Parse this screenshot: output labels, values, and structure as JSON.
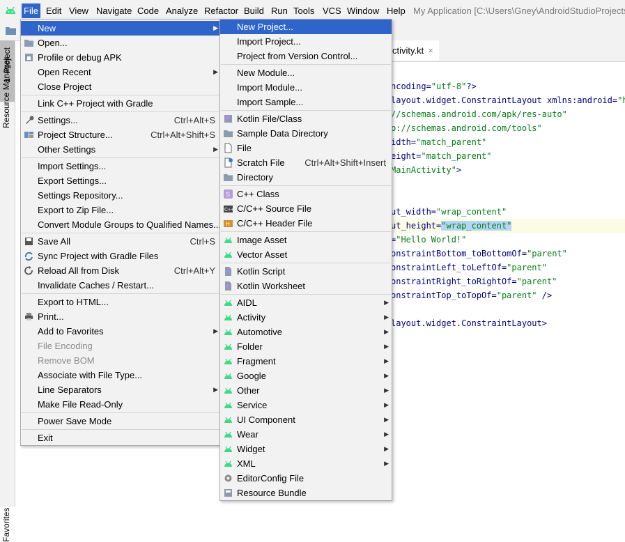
{
  "menubar": {
    "items": [
      "File",
      "Edit",
      "View",
      "Navigate",
      "Code",
      "Analyze",
      "Refactor",
      "Build",
      "Run",
      "Tools",
      "VCS",
      "Window",
      "Help"
    ],
    "window_title": "My Application [C:\\Users\\Gney\\AndroidStudioProjects\\"
  },
  "tool_windows": {
    "resource_manager": "Resource Manager",
    "project": "1: Project",
    "favorites": "Favorites"
  },
  "editor": {
    "tab_label": "ctivity.kt",
    "tab_close": "×",
    "lines": [
      {
        "pre": "ncoding=",
        "str": "\"utf-8\"",
        "post": "?>"
      },
      {
        "pre": "layout.widget.ConstraintLayout xmlns:android=",
        "str": "\"htt",
        "post": ""
      },
      {
        "pre": "",
        "str": "//schemas.android.com/apk/res-auto\"",
        "post": ""
      },
      {
        "pre": "",
        "str": "p://schemas.android.com/tools\"",
        "post": ""
      },
      {
        "pre": "idth=",
        "str": "\"match_parent\"",
        "post": ""
      },
      {
        "pre": "eight=",
        "str": "\"match_parent\"",
        "post": ""
      },
      {
        "pre": "",
        "str": "MainActivity\"",
        "post": ">"
      },
      {
        "pre": "",
        "str": "",
        "post": ""
      },
      {
        "pre": "",
        "str": "",
        "post": ""
      },
      {
        "pre": "ut_width=",
        "str": "\"wrap_content\"",
        "post": ""
      },
      {
        "pre": "ut_height=",
        "str": "\"wrap_content\"",
        "post": ""
      },
      {
        "pre": "=",
        "str": "\"Hello World!\"",
        "post": ""
      },
      {
        "pre": "onstraintBottom_toBottomOf=",
        "str": "\"parent\"",
        "post": ""
      },
      {
        "pre": "onstraintLeft_toLeftOf=",
        "str": "\"parent\"",
        "post": ""
      },
      {
        "pre": "onstraintRight_toRightOf=",
        "str": "\"parent\"",
        "post": ""
      },
      {
        "pre": "onstraintTop_toTopOf=",
        "str": "\"parent\"",
        "post": " />"
      },
      {
        "pre": "",
        "str": "",
        "post": ""
      },
      {
        "pre": "layout.widget.ConstraintLayout>",
        "str": "",
        "post": ""
      }
    ]
  },
  "file_menu": {
    "items": [
      {
        "label": "New",
        "submenu": true,
        "selected": true
      },
      {
        "label": "Open...",
        "icon": "folder-icon"
      },
      {
        "label": "Profile or debug APK",
        "icon": "apk-icon"
      },
      {
        "label": "Open Recent",
        "submenu": true
      },
      {
        "label": "Close Project"
      },
      {
        "sep": true
      },
      {
        "label": "Link C++ Project with Gradle"
      },
      {
        "sep": true
      },
      {
        "label": "Settings...",
        "shortcut": "Ctrl+Alt+S",
        "icon": "wrench-icon"
      },
      {
        "label": "Project Structure...",
        "shortcut": "Ctrl+Alt+Shift+S",
        "icon": "project-structure-icon"
      },
      {
        "label": "Other Settings",
        "submenu": true
      },
      {
        "sep": true
      },
      {
        "label": "Import Settings..."
      },
      {
        "label": "Export Settings..."
      },
      {
        "label": "Settings Repository..."
      },
      {
        "label": "Export to Zip File..."
      },
      {
        "label": "Convert Module Groups to Qualified Names..."
      },
      {
        "sep": true
      },
      {
        "label": "Save All",
        "shortcut": "Ctrl+S",
        "icon": "save-icon"
      },
      {
        "label": "Sync Project with Gradle Files",
        "icon": "gradle-sync-icon"
      },
      {
        "label": "Reload All from Disk",
        "shortcut": "Ctrl+Alt+Y",
        "icon": "reload-icon"
      },
      {
        "label": "Invalidate Caches / Restart..."
      },
      {
        "sep": true
      },
      {
        "label": "Export to HTML..."
      },
      {
        "label": "Print...",
        "icon": "print-icon"
      },
      {
        "label": "Add to Favorites",
        "submenu": true
      },
      {
        "label": "File Encoding",
        "disabled": true
      },
      {
        "label": "Remove BOM",
        "disabled": true
      },
      {
        "label": "Associate with File Type..."
      },
      {
        "label": "Line Separators",
        "submenu": true
      },
      {
        "label": "Make File Read-Only"
      },
      {
        "sep": true
      },
      {
        "label": "Power Save Mode"
      },
      {
        "sep": true
      },
      {
        "label": "Exit"
      }
    ]
  },
  "new_menu": {
    "items": [
      {
        "label": "New Project...",
        "selected": true
      },
      {
        "label": "Import Project..."
      },
      {
        "label": "Project from Version Control..."
      },
      {
        "sep": true
      },
      {
        "label": "New Module..."
      },
      {
        "label": "Import Module..."
      },
      {
        "label": "Import Sample..."
      },
      {
        "sep": true
      },
      {
        "label": "Kotlin File/Class",
        "icon": "kotlin-icon"
      },
      {
        "label": "Sample Data Directory",
        "icon": "folder-icon"
      },
      {
        "label": "File",
        "icon": "file-icon"
      },
      {
        "label": "Scratch File",
        "shortcut": "Ctrl+Alt+Shift+Insert",
        "icon": "scratch-file-icon"
      },
      {
        "label": "Directory",
        "icon": "folder-icon"
      },
      {
        "sep": true
      },
      {
        "label": "C++ Class",
        "icon": "cpp-class-icon"
      },
      {
        "label": "C/C++ Source File",
        "icon": "cpp-source-icon"
      },
      {
        "label": "C/C++ Header File",
        "icon": "cpp-header-icon"
      },
      {
        "sep": true
      },
      {
        "label": "Image Asset",
        "icon": "android-icon"
      },
      {
        "label": "Vector Asset",
        "icon": "android-icon"
      },
      {
        "sep": true
      },
      {
        "label": "Kotlin Script",
        "icon": "kotlin-script-icon"
      },
      {
        "label": "Kotlin Worksheet",
        "icon": "kotlin-script-icon"
      },
      {
        "sep": true
      },
      {
        "label": "AIDL",
        "submenu": true,
        "icon": "android-icon"
      },
      {
        "label": "Activity",
        "submenu": true,
        "icon": "android-icon"
      },
      {
        "label": "Automotive",
        "submenu": true,
        "icon": "android-icon"
      },
      {
        "label": "Folder",
        "submenu": true,
        "icon": "android-icon"
      },
      {
        "label": "Fragment",
        "submenu": true,
        "icon": "android-icon"
      },
      {
        "label": "Google",
        "submenu": true,
        "icon": "android-icon"
      },
      {
        "label": "Other",
        "submenu": true,
        "icon": "android-icon"
      },
      {
        "label": "Service",
        "submenu": true,
        "icon": "android-icon"
      },
      {
        "label": "UI Component",
        "submenu": true,
        "icon": "android-icon"
      },
      {
        "label": "Wear",
        "submenu": true,
        "icon": "android-icon"
      },
      {
        "label": "Widget",
        "submenu": true,
        "icon": "android-icon"
      },
      {
        "label": "XML",
        "submenu": true,
        "icon": "android-icon"
      },
      {
        "label": "EditorConfig File",
        "icon": "gear-icon"
      },
      {
        "label": "Resource Bundle",
        "icon": "resource-bundle-icon"
      }
    ]
  },
  "colors": {
    "selection": "#2f65ca",
    "menu_bg": "#f2f2f2",
    "android_green": "#3ddc84",
    "code_keyword": "#000080",
    "code_string": "#067d17"
  }
}
